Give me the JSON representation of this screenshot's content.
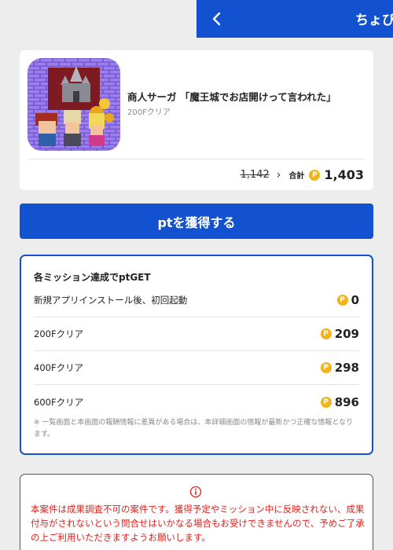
{
  "header": {
    "title": "ちょび",
    "back_icon": "chevron-left-icon"
  },
  "app": {
    "name": "商人サーガ 「魔王城でお店開けって言われた」",
    "condition": "200Fクリア",
    "old_points": "1,142",
    "total_label": "合計",
    "total_points": "1,403",
    "coin_symbol": "P"
  },
  "action": {
    "get_button_label": "ptを獲得する"
  },
  "missions": {
    "title": "各ミッション達成でptGET",
    "items": [
      {
        "label": "新規アプリインストール後、初回起動",
        "points": "0"
      },
      {
        "label": "200Fクリア",
        "points": "209"
      },
      {
        "label": "400Fクリア",
        "points": "298"
      },
      {
        "label": "600Fクリア",
        "points": "896"
      }
    ],
    "note": "※ 一覧画面と本画面の報酬情報に差異がある場合は、本詳細画面の情報が最新かつ正確な情報となります。"
  },
  "warning": {
    "icon": "info-icon",
    "text": "本案件は成果調査不可の案件です。獲得予定やミッション中に反映されない、成果付与がされないという問合せはいかなる場合もお受けできませんので、予めご了承の上ご利用いただきますようお願いします。"
  },
  "colors": {
    "accent": "#1251cf",
    "coin": "#f2b31b",
    "warning": "#e0201b",
    "background": "#ededed"
  }
}
